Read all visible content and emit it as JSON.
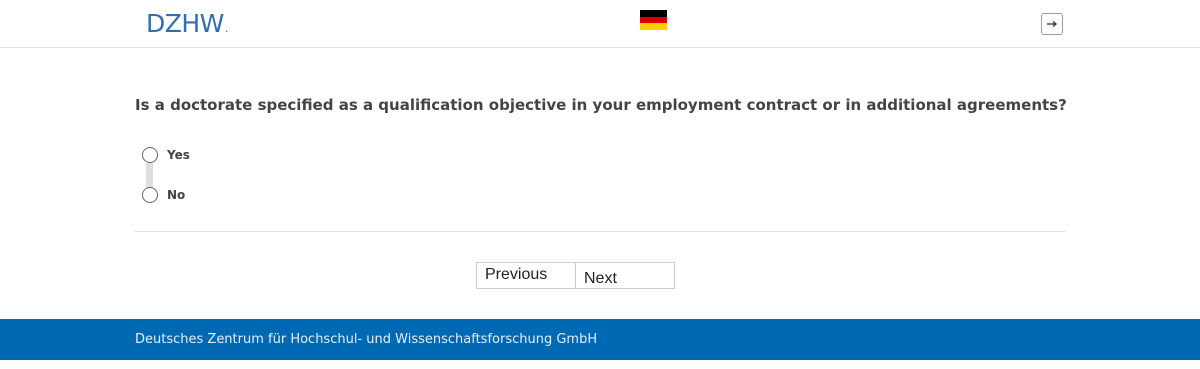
{
  "header": {
    "logo_text": "DZHW",
    "logo_dot": ".",
    "language_flag_icon": "german-flag-icon",
    "logout_icon": "logout-icon"
  },
  "question": {
    "text": "Is a doctorate specified as a qualification objective in your employment contract or in additional agreements?",
    "options": [
      {
        "label": "Yes",
        "selected": false
      },
      {
        "label": "No",
        "selected": false
      }
    ]
  },
  "navigation": {
    "previous_label": "Previous",
    "next_label": "Next"
  },
  "footer": {
    "text": "Deutsches Zentrum für Hochschul- und Wissenschaftsforschung GmbH"
  },
  "colors": {
    "brand_blue": "#0069b4",
    "logo_blue": "#2f6db5"
  }
}
